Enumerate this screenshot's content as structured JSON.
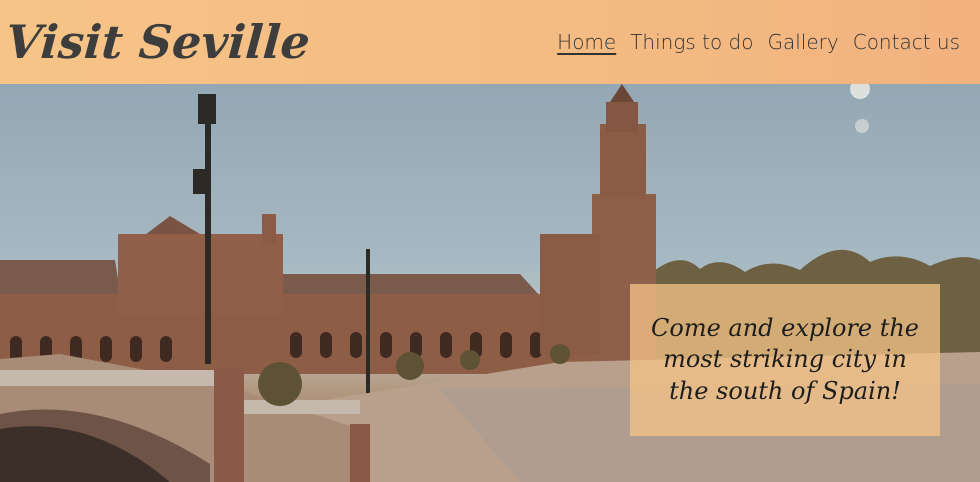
{
  "header": {
    "logo_text": "Visit Seville"
  },
  "nav": {
    "items": [
      {
        "label": "Home",
        "active": true
      },
      {
        "label": "Things to do",
        "active": false
      },
      {
        "label": "Gallery",
        "active": false
      },
      {
        "label": "Contact us",
        "active": false
      }
    ]
  },
  "hero": {
    "image_description_icon": "plaza-photo",
    "caption": "Come and explore the most striking city in the south of Spain!"
  },
  "colors": {
    "header_bg": "#f6c487",
    "caption_bg": "#f6c487",
    "text_dark": "#333333"
  }
}
